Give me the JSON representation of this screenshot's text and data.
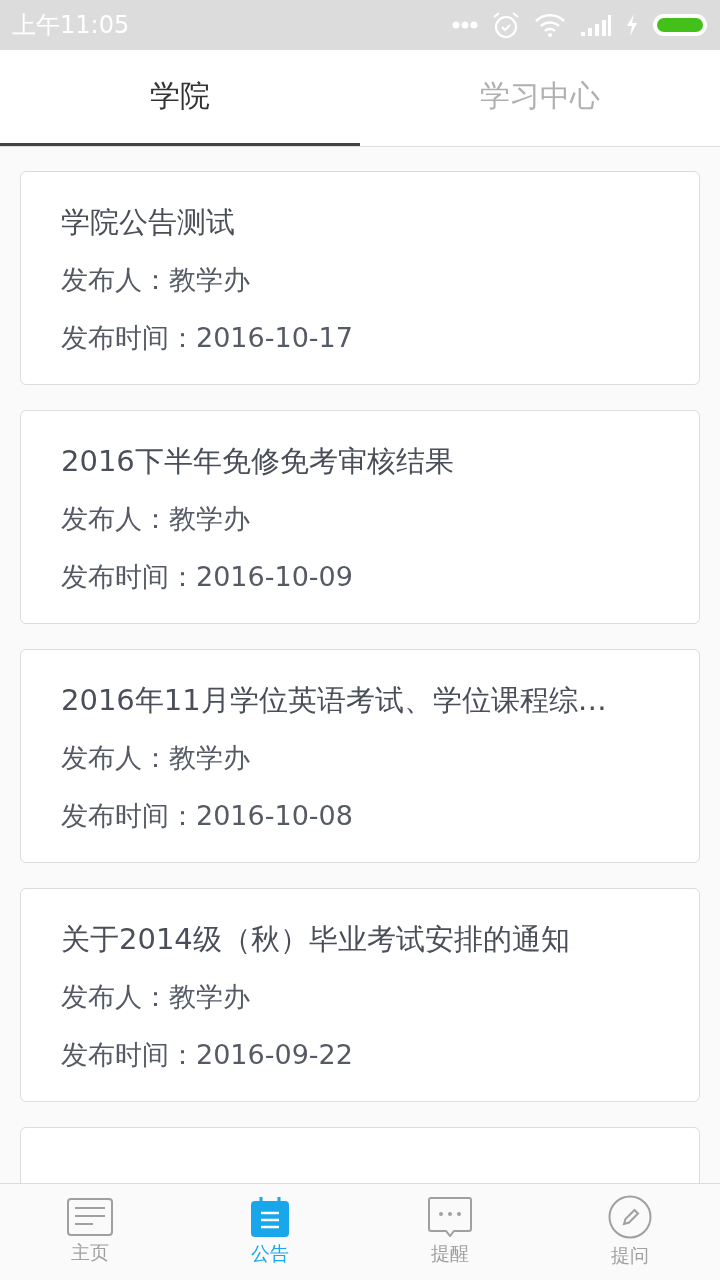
{
  "status_bar": {
    "time": "上午11:05"
  },
  "tabs": [
    {
      "label": "学院",
      "selected": true
    },
    {
      "label": "学习中心",
      "selected": false
    }
  ],
  "notices": [
    {
      "title": "学院公告测试",
      "publisher": "发布人：教学办",
      "date": "发布时间：2016-10-17"
    },
    {
      "title": "2016下半年免修免考审核结果",
      "publisher": "发布人：教学办",
      "date": "发布时间：2016-10-09"
    },
    {
      "title": "2016年11月学位英语考试、学位课程综…",
      "publisher": "发布人：教学办",
      "date": "发布时间：2016-10-08"
    },
    {
      "title": "关于2014级（秋）毕业考试安排的通知",
      "publisher": "发布人：教学办",
      "date": "发布时间：2016-09-22"
    }
  ],
  "more_cards_below": true,
  "bottom_nav": [
    {
      "label": "主页",
      "kind": "home",
      "selected": false
    },
    {
      "label": "公告",
      "kind": "notice",
      "selected": true
    },
    {
      "label": "提醒",
      "kind": "remind",
      "selected": false
    },
    {
      "label": "提问",
      "kind": "ask",
      "selected": false
    }
  ]
}
